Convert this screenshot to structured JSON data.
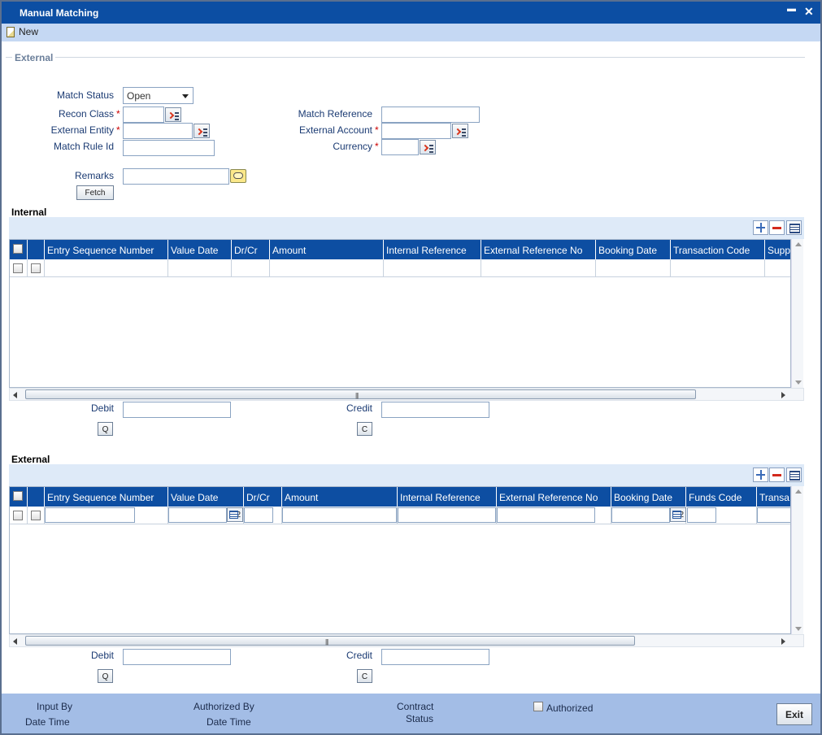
{
  "window": {
    "title": "Manual Matching",
    "minimize_glyph": "▬",
    "close_glyph": "✕"
  },
  "toolbar": {
    "new_label": "New"
  },
  "external_section": {
    "legend": "External",
    "match_status_label": "Match Status",
    "match_status_value": "Open",
    "recon_class_label": "Recon Class",
    "external_entity_label": "External Entity",
    "match_rule_id_label": "Match Rule Id",
    "match_reference_label": "Match Reference",
    "external_account_label": "External Account",
    "currency_label": "Currency",
    "remarks_label": "Remarks",
    "fetch_label": "Fetch",
    "required_mark": "*"
  },
  "internal_grid": {
    "title": "Internal",
    "columns": [
      "Entry Sequence Number",
      "Value Date",
      "Dr/Cr",
      "Amount",
      "Internal Reference",
      "External Reference No",
      "Booking Date",
      "Transaction Code",
      "Supp"
    ],
    "debit_label": "Debit",
    "credit_label": "Credit",
    "debit_btn": "Q",
    "credit_btn": "C"
  },
  "external_grid": {
    "title": "External",
    "columns": [
      "Entry Sequence Number",
      "Value Date",
      "Dr/Cr",
      "Amount",
      "Internal Reference",
      "External Reference No",
      "Booking Date",
      "Funds Code",
      "Transa"
    ],
    "calendar_glyph": "2",
    "debit_label": "Debit",
    "credit_label": "Credit",
    "debit_btn": "Q",
    "credit_btn": "C"
  },
  "footer": {
    "input_by": "Input By",
    "date_time_1": "Date Time",
    "authorized_by": "Authorized By",
    "date_time_2": "Date Time",
    "contract": "Contract",
    "status": "Status",
    "authorized": "Authorized",
    "exit": "Exit"
  },
  "colors": {
    "title_bar": "#0c4ea3",
    "toolbar": "#c5d8f3",
    "grid_header": "#0d4ea2",
    "footer": "#a3bde6",
    "label": "#1b3b73"
  }
}
